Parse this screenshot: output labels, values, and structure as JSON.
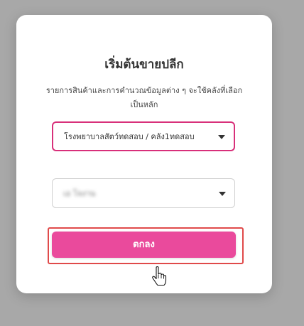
{
  "dialog": {
    "title": "เริ่มต้นขายปลีก",
    "description": "รายการสินค้าและการคำนวณข้อมูลต่าง ๆ จะใช้คลังที่เลือกเป็นหลัก",
    "branch_select": {
      "value": "โรงพยาบาลสัตว์ทดสอบ / คลัง1ทดสอบ"
    },
    "user_select": {
      "value": "เอ โจงาน"
    },
    "confirm_label": "ตกลง"
  },
  "colors": {
    "accent": "#ea4a9c",
    "focus_border": "#d8307a",
    "highlight_outline": "#e04a4a"
  }
}
